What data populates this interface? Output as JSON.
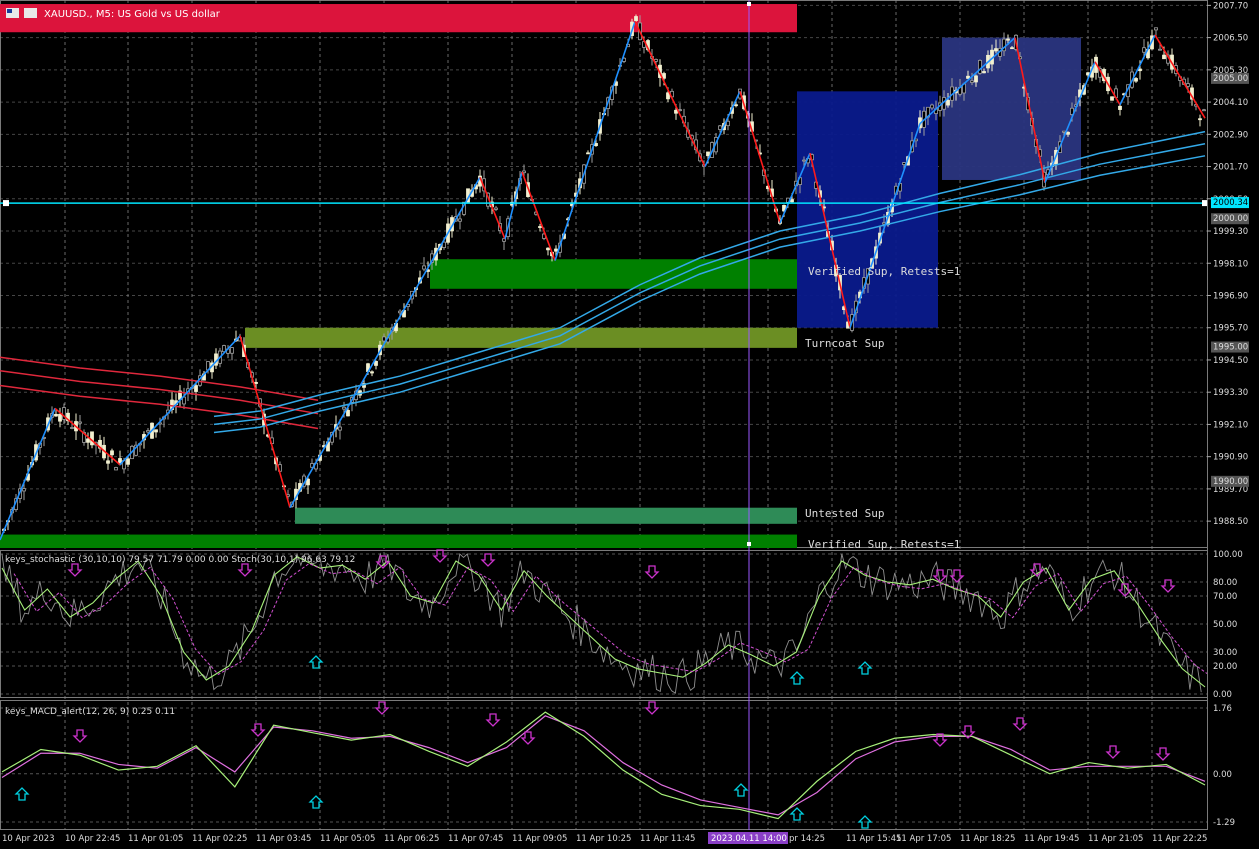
{
  "window": {
    "symbol_title": "XAUUSD., M5:  US Gold vs US dollar"
  },
  "colors": {
    "background": "#000000",
    "grid": "#8c8c8c",
    "bull_candle": "#f2f0d0",
    "bear_candle": "#a0a0a0",
    "zz_up": "#1e90ff",
    "zz_down": "#ff1a1a",
    "hline": "#00e5ff",
    "vline": "#9b59ff",
    "ma_red": "#e0283c",
    "ma_blue": "#33a9e8",
    "stoch_main": "#8f8f8f",
    "stoch_signal": "#a7f07a",
    "stoch_slow": "#d050d0",
    "macd_main": "#a7f07a",
    "macd_signal": "#e070e0",
    "arrow_down": "#cc33cc",
    "arrow_up": "#00d0e0"
  },
  "main_panel": {
    "price_levels": [
      "2007.70",
      "2006.50",
      "2005.30",
      "2004.10",
      "2002.90",
      "2001.70",
      "2000.50",
      "1999.30",
      "1998.10",
      "1996.90",
      "1995.70",
      "1994.50",
      "1993.30",
      "1992.10",
      "1990.90",
      "1989.70",
      "1988.50"
    ],
    "level_tags": [
      {
        "price": "2005.00"
      },
      {
        "price": "2000.34"
      },
      {
        "price": "2000.00"
      },
      {
        "price": "1995.00"
      },
      {
        "price": "1990.00"
      }
    ],
    "zones": [
      {
        "type": "resistance",
        "color": "#dc143c",
        "from": 2006.7,
        "to": 2007.75
      },
      {
        "type": "verified_support",
        "color": "#008000",
        "from": 1997.15,
        "to": 1998.25,
        "label": "Verified Sup, Retests=1"
      },
      {
        "type": "turncoat_support",
        "color": "#6b8e23",
        "from": 1994.95,
        "to": 1995.7,
        "label": "Turncoat Sup"
      },
      {
        "type": "untested_support",
        "color": "#2e8b57",
        "from": 1988.4,
        "to": 1989.0,
        "label": "Untested Sup"
      },
      {
        "type": "verified_support_low",
        "color": "#008000",
        "from": 1987.5,
        "to": 1988.0,
        "label": "Verified Sup, Retests=1"
      }
    ],
    "boxes": [
      {
        "color": "#0a1a8c",
        "from": 1995.7,
        "to": 2004.5
      },
      {
        "color": "#2a3580",
        "from": 2001.2,
        "to": 2006.5
      }
    ]
  },
  "stoch_panel": {
    "label": "keys_stochastic (30,10,10) 79.57 71.79 0.00 0.00  Stoch(30,10,1) 96.63 79.12",
    "levels": [
      "100.00",
      "80.00",
      "70.00",
      "50.00",
      "30.00",
      "20.00",
      "0.00"
    ]
  },
  "macd_panel": {
    "label": "keys_MACD_alert(12, 26, 9) 0.25 0.11",
    "levels": [
      "1.76",
      "0.00",
      "-1.29"
    ]
  },
  "time_axis": {
    "labels": [
      "10 Apr 2023",
      "10 Apr 22:45",
      "11 Apr 01:05",
      "11 Apr 02:25",
      "11 Apr 03:45",
      "11 Apr 05:05",
      "11 Apr 06:25",
      "11 Apr 07:45",
      "11 Apr 09:05",
      "11 Apr 10:25",
      "11 Apr 11:45",
      "pr 14:25",
      "11 Apr 15:45",
      "11 Apr 17:05",
      "11 Apr 18:25",
      "11 Apr 19:45",
      "11 Apr 21:05",
      "11 Apr 22:25"
    ],
    "cursor_label": "2023.04.11 14:00"
  },
  "chart_data": {
    "type": "candlestick",
    "symbol": "XAUUSD.",
    "timeframe": "M5",
    "ylim": [
      1987.5,
      2007.9
    ],
    "zigzag": [
      {
        "t": 0,
        "price": 1987.8
      },
      {
        "t": 55,
        "price": 1992.7
      },
      {
        "t": 120,
        "price": 1990.6
      },
      {
        "t": 240,
        "price": 1995.4
      },
      {
        "t": 290,
        "price": 1989.0
      },
      {
        "t": 480,
        "price": 2001.3
      },
      {
        "t": 505,
        "price": 1999.0
      },
      {
        "t": 522,
        "price": 2001.5
      },
      {
        "t": 555,
        "price": 1998.2
      },
      {
        "t": 635,
        "price": 2007.1
      },
      {
        "t": 705,
        "price": 2001.7
      },
      {
        "t": 740,
        "price": 2004.5
      },
      {
        "t": 780,
        "price": 1999.6
      },
      {
        "t": 810,
        "price": 2002.2
      },
      {
        "t": 850,
        "price": 1995.7
      },
      {
        "t": 920,
        "price": 2003.3
      },
      {
        "t": 1015,
        "price": 2006.5
      },
      {
        "t": 1045,
        "price": 2001.1
      },
      {
        "t": 1095,
        "price": 2005.6
      },
      {
        "t": 1120,
        "price": 2004.0
      },
      {
        "t": 1155,
        "price": 2006.6
      },
      {
        "t": 1205,
        "price": 2003.5
      }
    ],
    "stochastic_main_points": [
      90,
      60,
      75,
      55,
      65,
      82,
      95,
      70,
      30,
      10,
      20,
      45,
      85,
      98,
      90,
      92,
      82,
      95,
      70,
      65,
      95,
      85,
      60,
      88,
      70,
      55,
      40,
      25,
      18,
      15,
      12,
      22,
      35,
      28,
      20,
      30,
      70,
      95,
      85,
      80,
      78,
      82,
      75,
      70,
      55,
      80,
      90,
      60,
      82,
      88,
      65,
      40,
      18,
      5
    ],
    "macd_main_points": [
      0.05,
      0.65,
      0.5,
      0.1,
      0.2,
      0.75,
      -0.35,
      1.3,
      1.1,
      0.9,
      1.05,
      0.6,
      0.2,
      0.85,
      1.65,
      1.0,
      0.1,
      -0.55,
      -0.85,
      -0.95,
      -1.2,
      -0.2,
      0.6,
      0.95,
      1.05,
      1.0,
      0.5,
      0.0,
      0.3,
      0.15,
      0.25,
      -0.3
    ],
    "macd_signal_points": [
      -0.1,
      0.55,
      0.55,
      0.25,
      0.15,
      0.7,
      0.05,
      1.25,
      1.15,
      0.95,
      1.0,
      0.7,
      0.3,
      0.7,
      1.55,
      1.15,
      0.3,
      -0.3,
      -0.7,
      -0.9,
      -1.1,
      -0.5,
      0.4,
      0.85,
      1.0,
      1.0,
      0.65,
      0.1,
      0.2,
      0.2,
      0.2,
      -0.2
    ]
  }
}
